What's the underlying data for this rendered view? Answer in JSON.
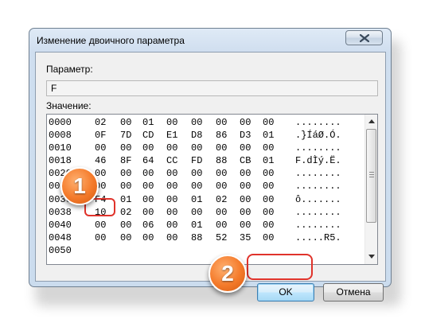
{
  "window": {
    "title": "Изменение двоичного параметра"
  },
  "dialog": {
    "param_label": "Параметр:",
    "param_value": "F",
    "value_label": "Значение:",
    "ok_label": "OK",
    "cancel_label": "Отмена"
  },
  "hex": {
    "rows": [
      {
        "addr": "0000",
        "bytes": [
          "02",
          "00",
          "01",
          "00",
          "00",
          "00",
          "00",
          "00"
        ],
        "ascii": "........"
      },
      {
        "addr": "0008",
        "bytes": [
          "0F",
          "7D",
          "CD",
          "E1",
          "D8",
          "86",
          "D3",
          "01"
        ],
        "ascii": ".}ÍáØ.Ó."
      },
      {
        "addr": "0010",
        "bytes": [
          "00",
          "00",
          "00",
          "00",
          "00",
          "00",
          "00",
          "00"
        ],
        "ascii": "........"
      },
      {
        "addr": "0018",
        "bytes": [
          "46",
          "8F",
          "64",
          "CC",
          "FD",
          "88",
          "CB",
          "01"
        ],
        "ascii": "F.dÌý.Ë."
      },
      {
        "addr": "0020",
        "bytes": [
          "00",
          "00",
          "00",
          "00",
          "00",
          "00",
          "00",
          "00"
        ],
        "ascii": "........"
      },
      {
        "addr": "0028",
        "bytes": [
          "00",
          "00",
          "00",
          "00",
          "00",
          "00",
          "00",
          "00"
        ],
        "ascii": "........"
      },
      {
        "addr": "0030",
        "bytes": [
          "F4",
          "01",
          "00",
          "00",
          "01",
          "02",
          "00",
          "00"
        ],
        "ascii": "ô......."
      },
      {
        "addr": "0038",
        "bytes": [
          "10",
          "02",
          "00",
          "00",
          "00",
          "00",
          "00",
          "00"
        ],
        "ascii": "........"
      },
      {
        "addr": "0040",
        "bytes": [
          "00",
          "00",
          "06",
          "00",
          "01",
          "00",
          "00",
          "00"
        ],
        "ascii": "........"
      },
      {
        "addr": "0048",
        "bytes": [
          "00",
          "00",
          "00",
          "00",
          "88",
          "52",
          "35",
          "00"
        ],
        "ascii": ".....R5."
      },
      {
        "addr": "0050",
        "bytes": [
          "",
          "",
          "",
          "",
          "",
          "",
          "",
          ""
        ],
        "ascii": ""
      }
    ]
  },
  "annotations": {
    "badge1": "1",
    "badge2": "2",
    "highlight_color": "#e0332b",
    "badge_color": "#f47a2a"
  },
  "icons": {
    "close": "close-icon",
    "up": "scroll-up-arrow-icon",
    "down": "scroll-down-arrow-icon"
  }
}
